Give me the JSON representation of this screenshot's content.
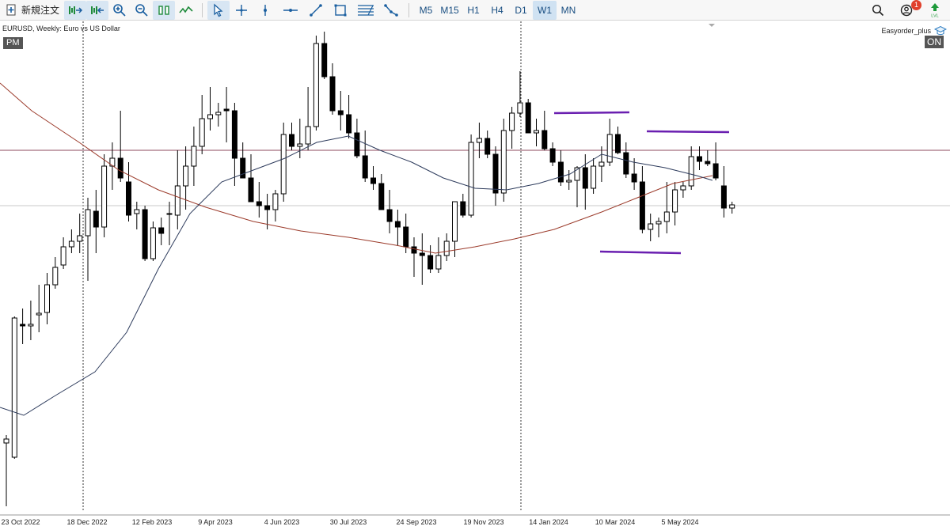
{
  "toolbar": {
    "new_order_label": "新規注文",
    "timeframes": [
      "M5",
      "M15",
      "H1",
      "H4",
      "D1",
      "W1",
      "MN"
    ],
    "active_timeframe": "W1",
    "notification_count": "1"
  },
  "chart": {
    "symbol_title": "EURUSD, Weekly:  Euro vs US Dollar",
    "pm_badge": "PM",
    "ea_name": "Easyorder_plus",
    "ea_status": "ON",
    "date_labels": [
      "23 Oct 2022",
      "18 Dec 2022",
      "12 Feb 2023",
      "9 Apr 2023",
      "4 Jun 2023",
      "30 Jul 2023",
      "24 Sep 2023",
      "19 Nov 2023",
      "14 Jan 2024",
      "10 Mar 2024",
      "5 May 2024"
    ],
    "colors": {
      "bull_body": "#ffffff",
      "bear_body": "#000000",
      "fast_ma": "#2d3b5c",
      "slow_ma": "#9b3a2a",
      "trendline": "#6a1fb0",
      "horizontal_line": "#8c4a5e",
      "bid_line": "#c8c8c8"
    }
  }
}
